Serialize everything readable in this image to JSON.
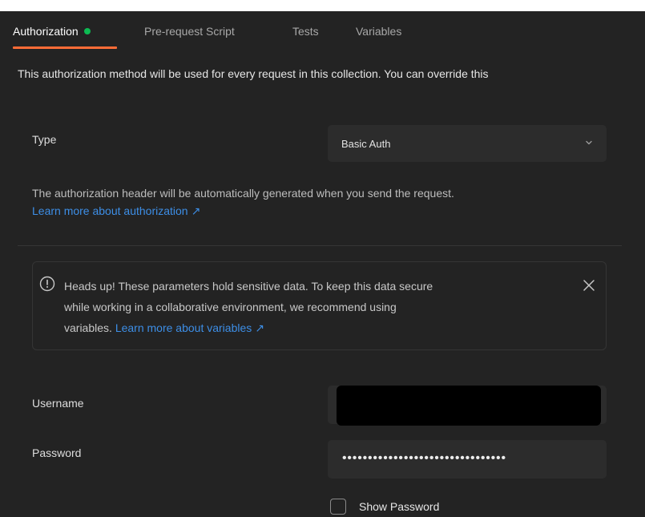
{
  "tabs": [
    {
      "label": "Authorization",
      "active": true,
      "has_status_dot": true
    },
    {
      "label": "Pre-request Script",
      "active": false
    },
    {
      "label": "Tests",
      "active": false
    },
    {
      "label": "Variables",
      "active": false
    }
  ],
  "description": "This authorization method will be used for every request in this collection. You can override this",
  "auth_type": {
    "label": "Type",
    "selected": "Basic Auth"
  },
  "info": {
    "text": "The authorization header will be automatically generated when you send the request.",
    "link": "Learn more about authorization"
  },
  "alert": {
    "text_line1": "Heads up! These parameters hold sensitive data. To keep this data secure",
    "text_line2": "while working in a collaborative environment, we recommend using",
    "text_line3_prefix": "variables.",
    "link": "Learn more about variables"
  },
  "username": {
    "label": "Username",
    "value_redacted": true
  },
  "password": {
    "label": "Password",
    "masked_value": "••••••••••••••••••••••••••••••••"
  },
  "show_password": {
    "label": "Show Password",
    "checked": false
  },
  "colors": {
    "background": "#232323",
    "accent_tab_underline": "#ff6c37",
    "status_dot": "#0cbb52",
    "link": "#3d8ee6",
    "input_bg": "#2c2c2c"
  },
  "icons": {
    "chevron": "chevron-down-icon",
    "external_link": "arrow-up-right-icon",
    "alert": "info-circle-icon",
    "close": "close-icon"
  }
}
